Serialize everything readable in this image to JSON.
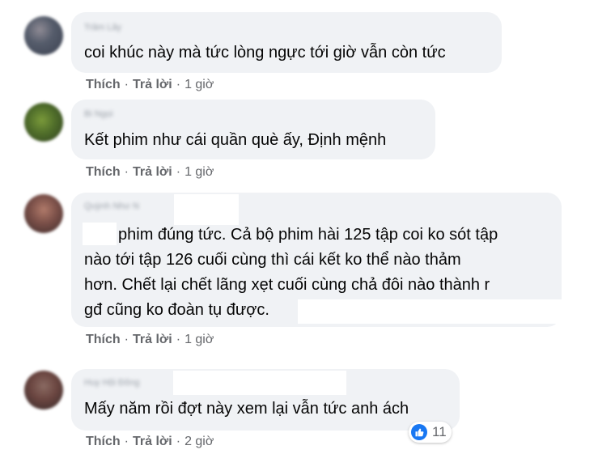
{
  "comments": [
    {
      "author": "Trâm Lây",
      "text": "coi khúc này mà tức lòng ngực tới giờ vẫn còn tức",
      "like_label": "Thích",
      "reply_label": "Trả lời",
      "time": "1 giờ"
    },
    {
      "author": "Bi Ngọi",
      "text": "Kết phim như cái quần què ấy, Định mệnh",
      "like_label": "Thích",
      "reply_label": "Trả lời",
      "time": "1 giờ"
    },
    {
      "author": "Quỳnh Như N",
      "text_lines": [
        "phim đúng tức. Cả bộ phim hài 125 tập coi ko sót tập",
        "nào tới tập 126 cuối cùng thì cái kết ko thể nào thảm",
        "hơn. Chết lại chết lãng xẹt cuối cùng chả đôi nào thành r",
        "gđ cũng ko đoàn tụ được."
      ],
      "like_label": "Thích",
      "reply_label": "Trả lời",
      "time": "1 giờ"
    },
    {
      "author": "Huy Hội Đông",
      "text": "Mấy năm rồi đợt này xem lại vẫn tức anh ách",
      "like_label": "Thích",
      "reply_label": "Trả lời",
      "time": "2 giờ",
      "reaction_icon": "like-icon",
      "reaction_count": "11"
    }
  ],
  "separator": "·",
  "colors": {
    "bubble": "#f0f2f5",
    "secondary_text": "#65676b",
    "like_blue": "#1877f2"
  }
}
